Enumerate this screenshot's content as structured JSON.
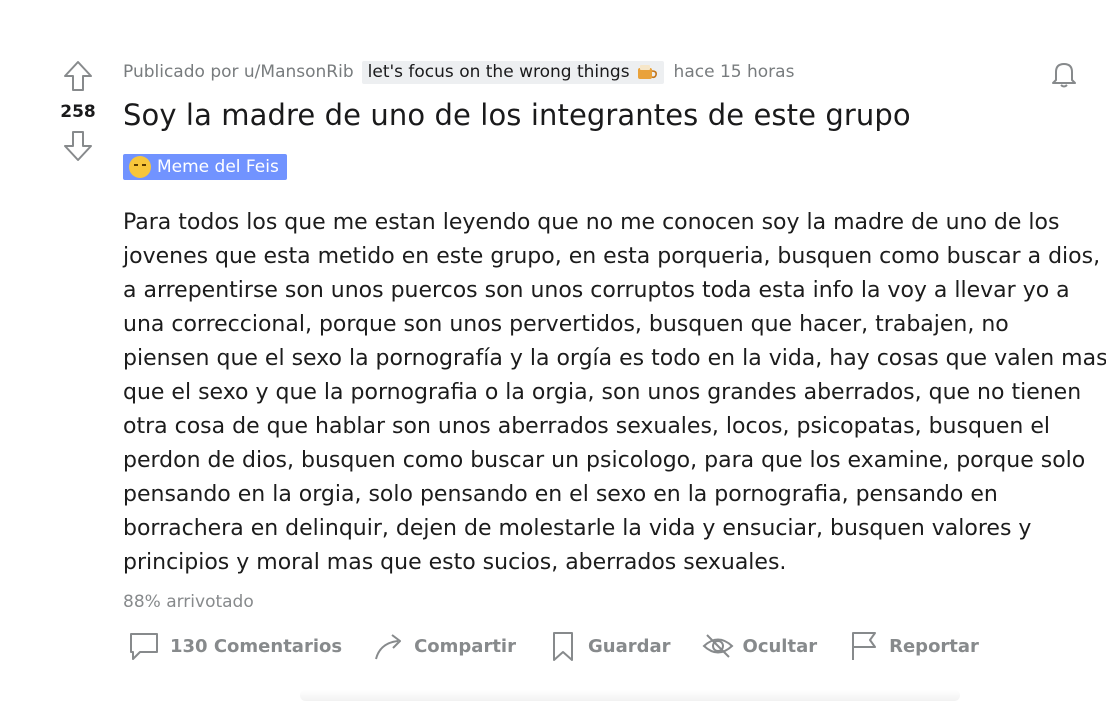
{
  "vote": {
    "score": "258"
  },
  "meta": {
    "posted_by": "Publicado por u/MansonRib",
    "author_flair": "let's focus on the wrong things",
    "time": "hace 15 horas"
  },
  "post": {
    "title": "Soy la madre de uno de los integrantes de este grupo",
    "flair": "Meme del Feis",
    "flair_color": "#7193ff",
    "body_lines": [
      "Para todos los que me estan leyendo que no me conocen soy la madre de uno de los",
      "jovenes que esta metido en este grupo, en esta porqueria, busquen como buscar a dios,",
      "a arrepentirse son unos puercos son unos corruptos toda esta info la voy a llevar yo a",
      "una correccional, porque son unos pervertidos, busquen que hacer, trabajen, no",
      "piensen que el sexo la pornografía y la orgía es todo en la vida, hay cosas que valen mas",
      "que el sexo y que la pornografia o la orgia, son unos grandes aberrados, que no tienen",
      "otra cosa de que hablar son unos aberrados sexuales, locos, psicopatas, busquen el",
      "perdon de dios, busquen como buscar un psicologo, para que los examine, porque solo",
      "pensando en la orgia, solo pensando en el sexo en la pornografia, pensando en",
      "borrachera en delinquir, dejen de molestarle la vida y ensuciar, busquen valores y",
      "principios y moral mas que esto sucios, aberrados sexuales."
    ],
    "upvote_ratio": "88% arrivotado"
  },
  "actions": {
    "comments": "130 Comentarios",
    "share": "Compartir",
    "save": "Guardar",
    "hide": "Ocultar",
    "report": "Reportar"
  },
  "icons": {
    "upvote": "arrow-up-icon",
    "downvote": "arrow-down-icon",
    "bell": "bell-icon",
    "comments": "comment-bubble-icon",
    "share": "share-arrow-icon",
    "save": "bookmark-icon",
    "hide": "eye-slash-icon",
    "report": "flag-icon"
  }
}
